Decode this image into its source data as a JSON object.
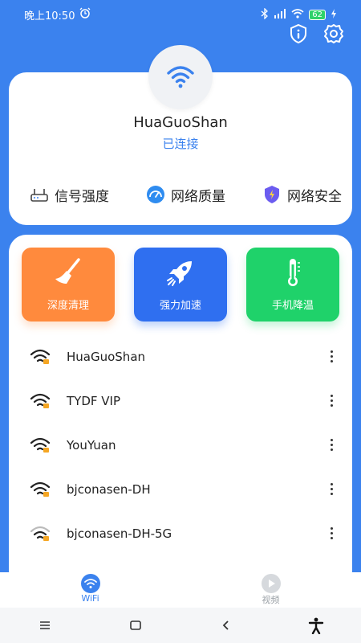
{
  "status_bar": {
    "time": "晚上10:50",
    "battery": "62"
  },
  "header": {
    "icons": [
      "info-shield-icon",
      "settings-gear-icon"
    ]
  },
  "connection": {
    "ssid": "HuaGuoShan",
    "status": "已连接",
    "features": [
      {
        "label": "信号强度",
        "icon": "router-signal-icon"
      },
      {
        "label": "网络质量",
        "icon": "speed-gauge-icon"
      },
      {
        "label": "网络安全",
        "icon": "security-shield-icon"
      }
    ]
  },
  "tools": [
    {
      "label": "深度清理",
      "icon": "broom-icon",
      "color": "#ff8a3d"
    },
    {
      "label": "强力加速",
      "icon": "rocket-icon",
      "color": "#2f6ff0"
    },
    {
      "label": "手机降温",
      "icon": "thermometer-icon",
      "color": "#1fd26a"
    }
  ],
  "networks": [
    {
      "name": "HuaGuoShan"
    },
    {
      "name": "TYDF VIP"
    },
    {
      "name": "YouYuan"
    },
    {
      "name": "bjconasen-DH"
    },
    {
      "name": "bjconasen-DH-5G"
    }
  ],
  "tabs": [
    {
      "label": "WiFi",
      "icon": "wifi-icon",
      "active": true
    },
    {
      "label": "视频",
      "icon": "video-play-icon",
      "active": false
    }
  ],
  "colors": {
    "primary": "#3b82ee",
    "orange": "#ff8a3d",
    "blue": "#2f6ff0",
    "green": "#1fd26a"
  }
}
